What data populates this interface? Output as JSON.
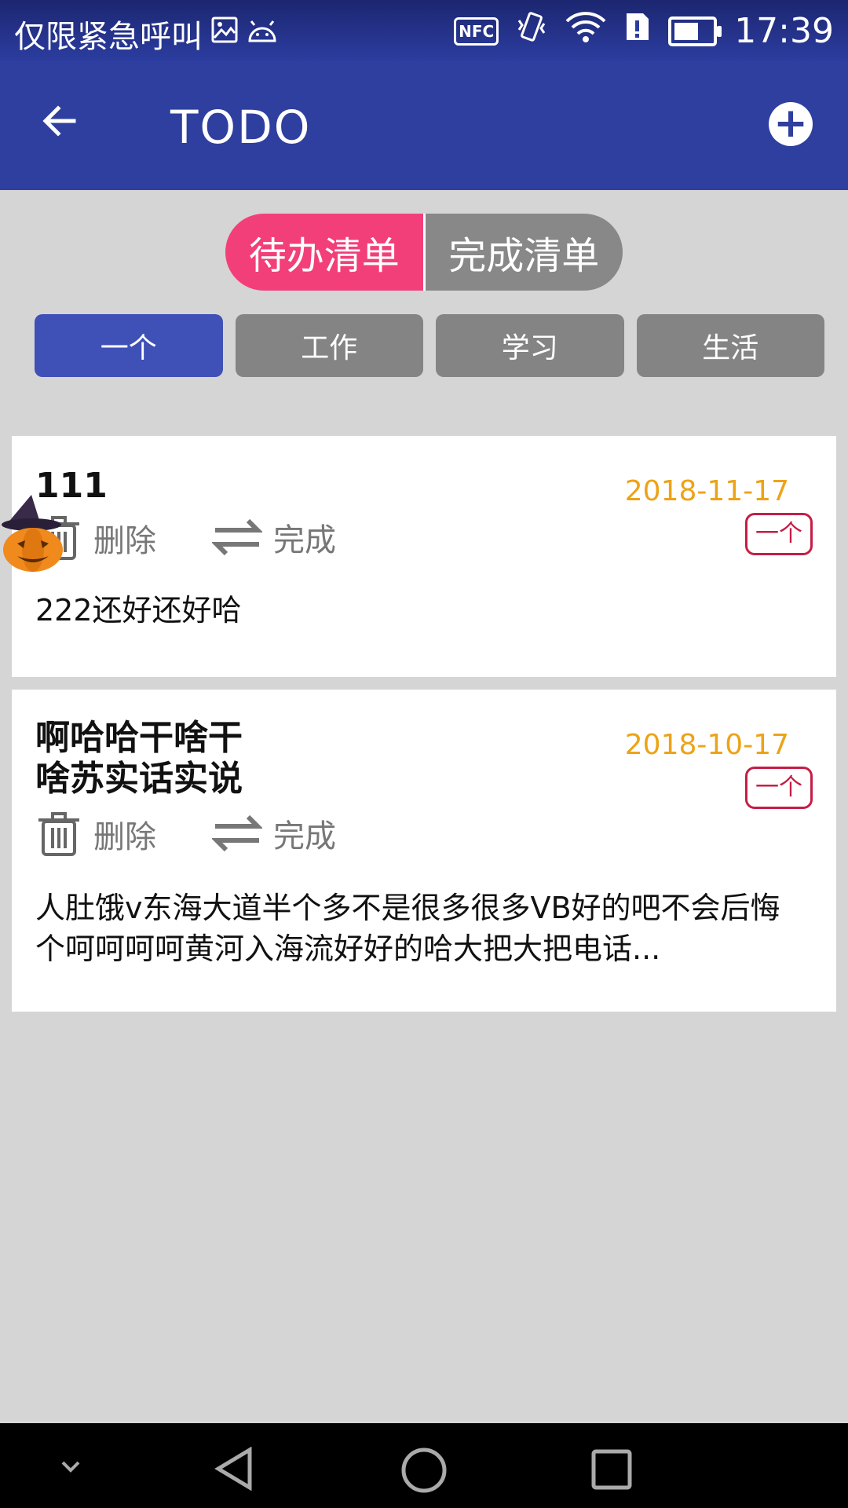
{
  "status_bar": {
    "carrier_text": "仅限紧急呼叫",
    "nfc_label": "NFC",
    "time": "17:39",
    "icons": [
      "gallery-icon",
      "android-icon",
      "nfc-icon",
      "vibrate-icon",
      "wifi-icon",
      "sim-icon",
      "battery-charging-icon"
    ]
  },
  "app_bar": {
    "title": "TODO",
    "back_icon": "arrow-left-icon",
    "add_icon": "plus-circle-icon"
  },
  "segment": {
    "active_label": "待办清单",
    "inactive_label": "完成清单",
    "active_color": "#f23f7a"
  },
  "categories": [
    {
      "label": "一个",
      "active": true
    },
    {
      "label": "工作",
      "active": false
    },
    {
      "label": "学习",
      "active": false
    },
    {
      "label": "生活",
      "active": false
    }
  ],
  "todos": [
    {
      "title": "111",
      "date": "2018-11-17",
      "tag": "一个",
      "delete_label": "删除",
      "complete_label": "完成",
      "body": "222还好还好哈"
    },
    {
      "title": "啊哈哈干啥干\n啥苏实话实说",
      "date": "2018-10-17",
      "tag": "一个",
      "delete_label": "删除",
      "complete_label": "完成",
      "body": "人肚饿v东海大道半个多不是很多很多VB好的吧不会后悔个呵呵呵呵黄河入海流好好的哈大把大把电话..."
    }
  ],
  "colors": {
    "primary": "#2e3f9f",
    "accent": "#f23f7a",
    "date": "#eda317",
    "tag": "#c41e45"
  },
  "nav_bar": {
    "icons": [
      "chevron-down-icon",
      "back-triangle-icon",
      "home-circle-icon",
      "recents-square-icon"
    ]
  }
}
